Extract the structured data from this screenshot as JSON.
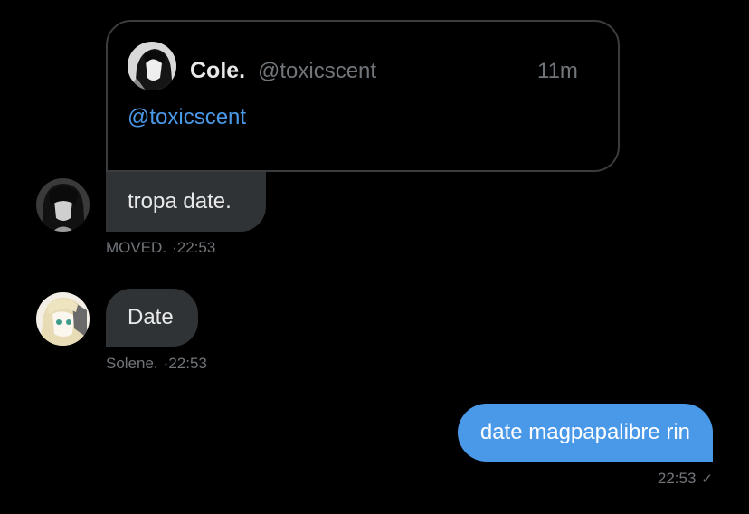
{
  "quoted_tweet": {
    "display_name": "Cole.",
    "handle": "@toxicscent",
    "time_ago": "11m",
    "text": "@toxicscent"
  },
  "messages": [
    {
      "sender": "MOVED.",
      "text": "tropa date.",
      "time": "22:53",
      "avatar_icon": "avatar-dark-hair"
    },
    {
      "sender": "Solene.",
      "text": "Date",
      "time": "22:53",
      "avatar_icon": "avatar-blonde-hair"
    },
    {
      "sender": "me",
      "text": "date magpapalibre rin",
      "time": "22:53",
      "status_icon": "check-icon"
    }
  ],
  "colors": {
    "background": "#000000",
    "incoming_bubble": "#2f3336",
    "outgoing_bubble": "#4a99e9",
    "link": "#4a99e9",
    "secondary_text": "#71767b"
  }
}
